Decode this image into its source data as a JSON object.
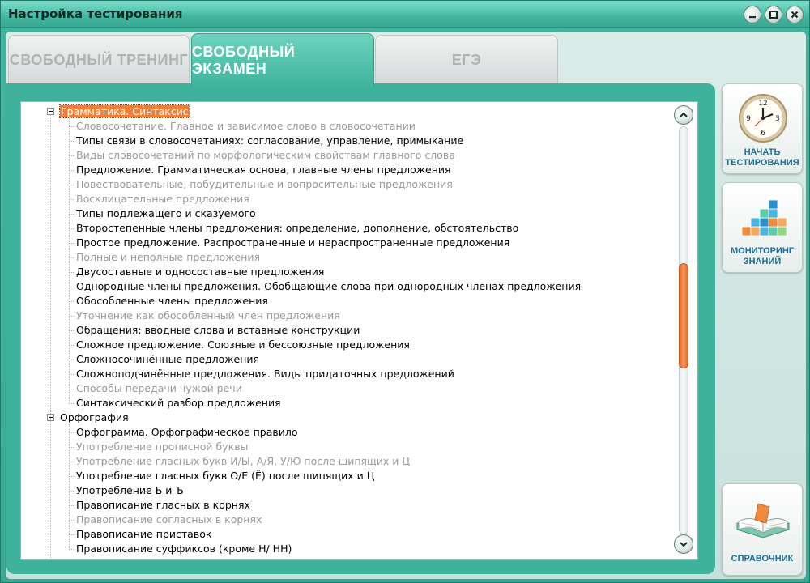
{
  "window": {
    "title": "Настройка тестирования",
    "controls": [
      "minimize-icon",
      "maximize-icon",
      "close-icon"
    ]
  },
  "tabs": [
    {
      "label": "СВОБОДНЫЙ ТРЕНИНГ",
      "active": false
    },
    {
      "label": "СВОБОДНЫЙ ЭКЗАМЕН",
      "active": true
    },
    {
      "label": "ЕГЭ",
      "active": false
    }
  ],
  "tree": {
    "groups": [
      {
        "label": "Грамматика. Синтаксис",
        "selected": true,
        "expanded": true,
        "items": [
          {
            "label": "Словосочетание. Главное и зависимое слово в словосочетании",
            "enabled": false
          },
          {
            "label": "Типы связи в словосочетаниях: согласование, управление, примыкание",
            "enabled": true
          },
          {
            "label": "Виды словосочетаний по морфологическим свойствам главного слова",
            "enabled": false
          },
          {
            "label": "Предложение. Грамматическая основа, главные члены предложения",
            "enabled": true
          },
          {
            "label": "Повествовательные, побудительные и вопросительные предложения",
            "enabled": false
          },
          {
            "label": "Восклицательные предложения",
            "enabled": false
          },
          {
            "label": "Типы подлежащего и сказуемого",
            "enabled": true
          },
          {
            "label": "Второстепенные члены предложения: определение, дополнение, обстоятельство",
            "enabled": true
          },
          {
            "label": "Простое предложение. Распространенные и нераспространенные предложения",
            "enabled": true
          },
          {
            "label": "Полные и неполные предложения",
            "enabled": false
          },
          {
            "label": "Двусоставные и односоставные предложения",
            "enabled": true
          },
          {
            "label": "Однородные члены предложения. Обобщающие слова при однородных членах предложения",
            "enabled": true
          },
          {
            "label": "Обособленные члены предложения",
            "enabled": true
          },
          {
            "label": "Уточнение как обособленный член предложения",
            "enabled": false
          },
          {
            "label": "Обращения; вводные слова и вставные конструкции",
            "enabled": true
          },
          {
            "label": "Сложное предложение. Союзные и бессоюзные предложения",
            "enabled": true
          },
          {
            "label": "Сложносочинённые предложения",
            "enabled": true
          },
          {
            "label": "Сложноподчинённые предложения. Виды придаточных предложений",
            "enabled": true
          },
          {
            "label": "Способы передачи чужой речи",
            "enabled": false
          },
          {
            "label": "Синтаксический разбор предложения",
            "enabled": true
          }
        ]
      },
      {
        "label": "Орфография",
        "selected": false,
        "expanded": true,
        "items": [
          {
            "label": "Орфограмма. Орфографическое правило",
            "enabled": true
          },
          {
            "label": "Употребление прописной буквы",
            "enabled": false
          },
          {
            "label": "Употребление гласных букв И/Ы, А/Я, У/Ю после шипящих и Ц",
            "enabled": false
          },
          {
            "label": "Употребление гласных букв О/Е (Ё) после шипящих и Ц",
            "enabled": true
          },
          {
            "label": "Употребление Ь и Ъ",
            "enabled": true
          },
          {
            "label": "Правописание гласных в корнях",
            "enabled": true
          },
          {
            "label": "Правописание согласных в корнях",
            "enabled": false
          },
          {
            "label": "Правописание приставок",
            "enabled": true
          },
          {
            "label": "Правописание суффиксов (кроме Н/ НН)",
            "enabled": true
          }
        ]
      }
    ]
  },
  "scrollbar": {
    "position": 0.38
  },
  "side_buttons": {
    "start": {
      "label_line1": "НАЧАТЬ",
      "label_line2": "ТЕСТИРОВАНИЯ",
      "icon": "clock-icon",
      "clock_numbers": [
        "12",
        "3",
        "6",
        "9"
      ]
    },
    "monitor": {
      "label_line1": "МОНИТОРИНГ",
      "label_line2": "ЗНАНИЙ",
      "icon": "chart-cubes-icon"
    },
    "reference": {
      "label": "СПРАВОЧНИК",
      "icon": "book-icon"
    }
  },
  "colors": {
    "accent": "#3eb29b",
    "selection": "#f07f3a",
    "scroll_thumb": "#f28c4a",
    "button_text": "#1d6f96"
  }
}
